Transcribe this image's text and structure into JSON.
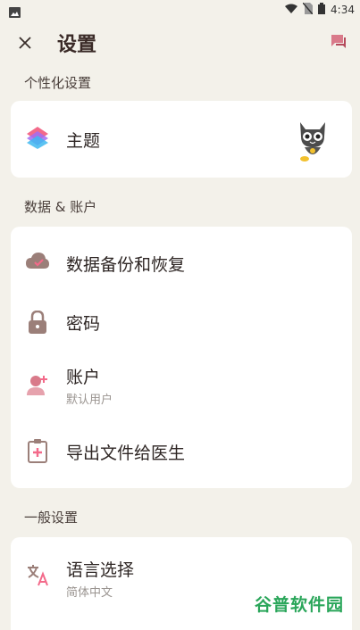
{
  "status_bar": {
    "time": "4:34"
  },
  "app_bar": {
    "title": "设置"
  },
  "sections": {
    "personalization": {
      "title": "个性化设置",
      "theme_label": "主题"
    },
    "data_account": {
      "title": "数据 & 账户",
      "backup_label": "数据备份和恢复",
      "password_label": "密码",
      "account_label": "账户",
      "account_sub": "默认用户",
      "export_label": "导出文件给医生"
    },
    "general": {
      "title": "一般设置",
      "language_label": "语言选择",
      "language_sub": "简体中文"
    }
  },
  "watermark": "谷普软件园",
  "colors": {
    "accent_pink": "#d97a8a",
    "icon_brown": "#9b7f79",
    "background": "#f3f1ea"
  }
}
